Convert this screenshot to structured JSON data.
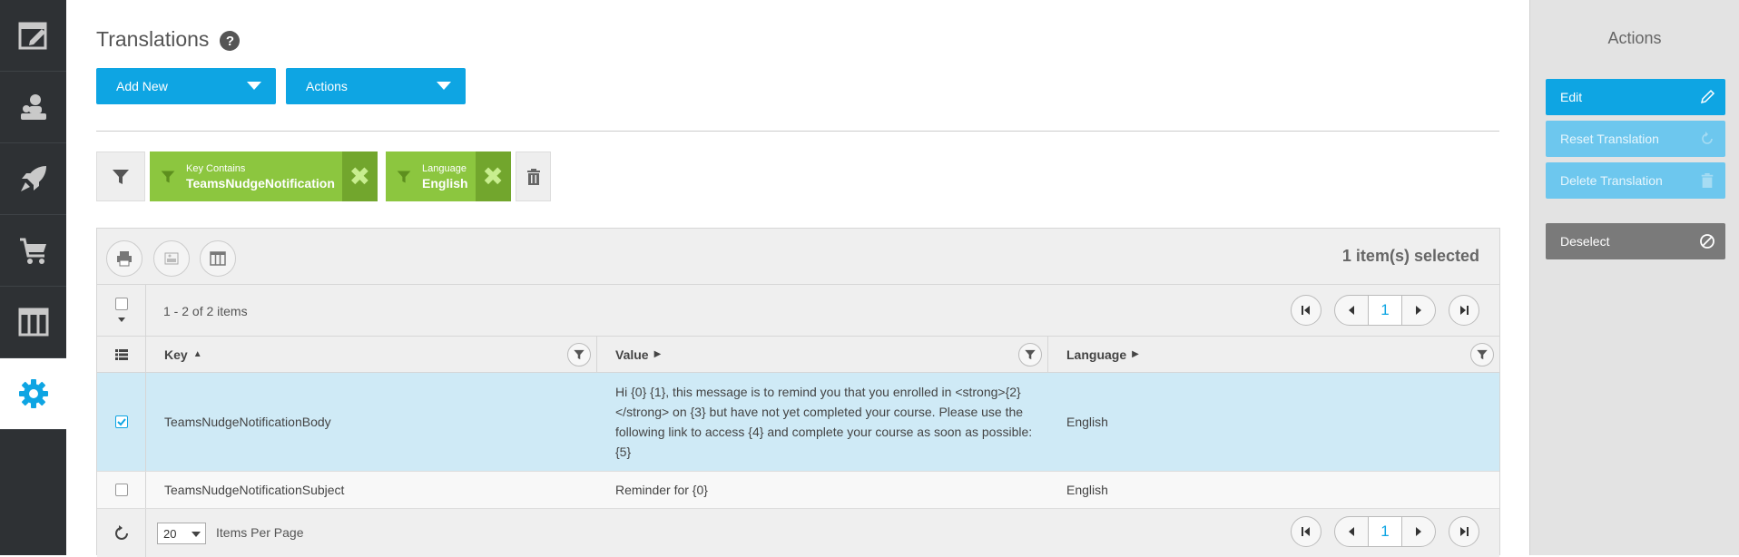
{
  "nav": {
    "items": [
      {
        "name": "edit-window-icon"
      },
      {
        "name": "users-icon"
      },
      {
        "name": "rocket-icon"
      },
      {
        "name": "cart-icon"
      },
      {
        "name": "columns-icon"
      },
      {
        "name": "gear-icon",
        "active": true
      }
    ]
  },
  "header": {
    "title": "Translations",
    "help_icon": "?"
  },
  "toolbar": {
    "add_new_label": "Add New",
    "actions_label": "Actions"
  },
  "filters": [
    {
      "label": "Key Contains",
      "value": "TeamsNudgeNotification"
    },
    {
      "label": "Language",
      "value": "English"
    }
  ],
  "grid": {
    "selected_count": "1 item(s) selected",
    "pager_info": "1 - 2 of 2 items",
    "current_page": "1",
    "columns": [
      {
        "label": "Key",
        "sort": "asc"
      },
      {
        "label": "Value",
        "sort": "none"
      },
      {
        "label": "Language",
        "sort": "none"
      }
    ],
    "rows": [
      {
        "selected": true,
        "key": "TeamsNudgeNotificationBody",
        "value": "Hi {0} {1}, this message is to remind you that you enrolled in <strong>{2}</strong> on {3} but have not yet completed your course. Please use the following link to access {4} and complete your course as soon as possible: {5}",
        "language": "English"
      },
      {
        "selected": false,
        "key": "TeamsNudgeNotificationSubject",
        "value": "Reminder for {0}",
        "language": "English"
      }
    ],
    "per_page_value": "20",
    "per_page_label": "Items Per Page"
  },
  "actions_panel": {
    "title": "Actions",
    "edit_label": "Edit",
    "reset_label": "Reset Translation",
    "delete_label": "Delete Translation",
    "deselect_label": "Deselect"
  },
  "colors": {
    "accent": "#0ea5e3",
    "filter_chip": "#8cc63f",
    "selected_row": "#cfeaf6",
    "nav_bg": "#2e3134"
  }
}
